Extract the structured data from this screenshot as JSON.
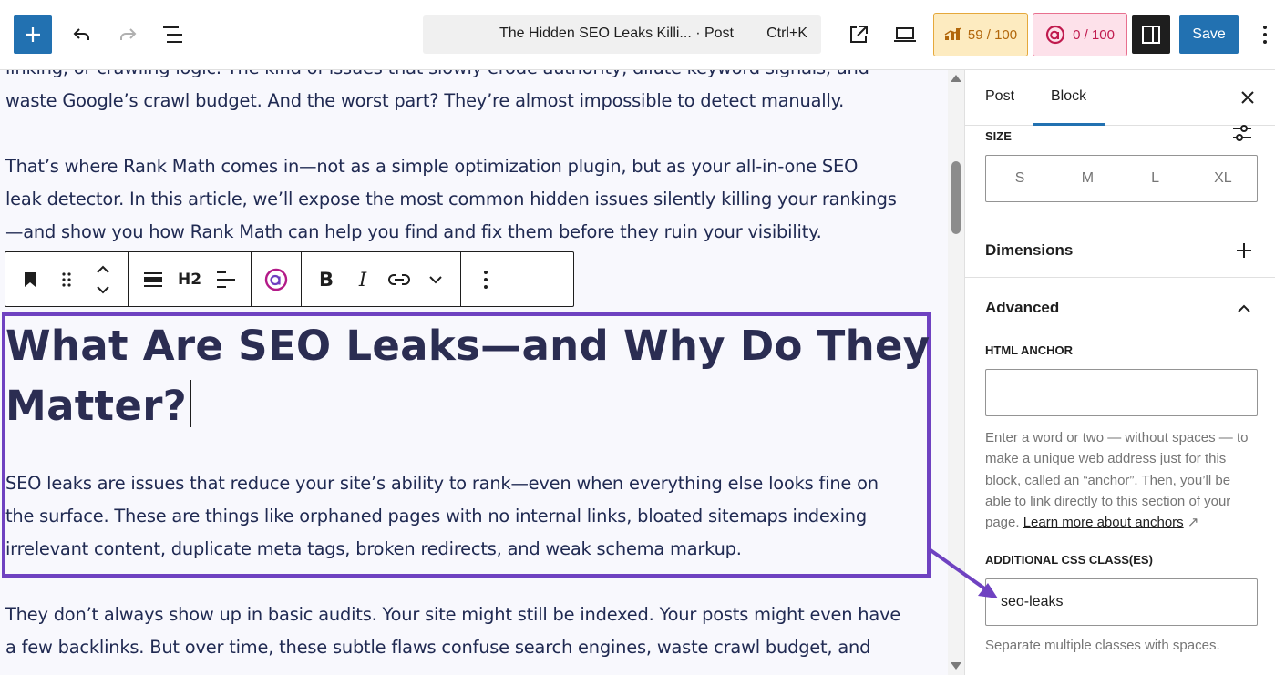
{
  "toolbar": {
    "document_title": "The Hidden SEO Leaks Killi... · Post",
    "shortcut": "Ctrl+K",
    "rank_math_score": "59 / 100",
    "content_ai_score": "0 / 100",
    "save_label": "Save"
  },
  "block_toolbar": {
    "heading_level": "H2",
    "bold": "B",
    "italic": "I"
  },
  "editor": {
    "paragraph_top": [
      "linking, or crawling logic. The kind of issues that slowly erode authority, dilute keyword signals, and",
      "waste Google’s crawl budget. And the worst part? They’re almost impossible to detect manually."
    ],
    "paragraph_intro": [
      "That’s where Rank Math comes in—not as a simple optimization plugin, but as your all-in-one SEO",
      "leak detector. In this article, we’ll expose the most common hidden issues silently killing your rankings",
      "—and show you how Rank Math can help you find and fix them before they ruin your visibility."
    ],
    "heading": [
      "What Are SEO Leaks—and Why Do They",
      "Matter?"
    ],
    "paragraph_selected": [
      "SEO leaks are issues that reduce your site’s ability to rank—even when everything else looks fine on",
      "the surface. These are things like orphaned pages with no internal links, bloated sitemaps indexing",
      "irrelevant content, duplicate meta tags, broken redirects, and weak schema markup."
    ],
    "paragraph_bottom": [
      "They don’t always show up in basic audits. Your site might still be indexed. Your posts might even have",
      "a few backlinks. But over time, these subtle flaws confuse search engines, waste crawl budget, and"
    ]
  },
  "sidebar": {
    "tabs": [
      "Post",
      "Block"
    ],
    "active_tab": "Block",
    "size_label": "SIZE",
    "size_options": [
      "S",
      "M",
      "L",
      "XL"
    ],
    "dimensions_label": "Dimensions",
    "advanced_label": "Advanced",
    "html_anchor_label": "HTML ANCHOR",
    "html_anchor_value": "",
    "anchor_help_lines": [
      "Enter a word or two — without spaces — to",
      "make a unique web address just for this",
      "block, called an “anchor”. Then, you’ll be",
      "able to link directly to this section of your"
    ],
    "anchor_help_prefix": "page.",
    "anchor_help_link": "Learn more about anchors",
    "anchor_help_link_icon": "↗",
    "css_class_label": "ADDITIONAL CSS CLASS(ES)",
    "css_class_value": "seo-leaks",
    "css_class_help": "Separate multiple classes with spaces."
  },
  "colors": {
    "accent": "#2271b1",
    "selection": "#6f42c1",
    "text": "#202a52"
  }
}
